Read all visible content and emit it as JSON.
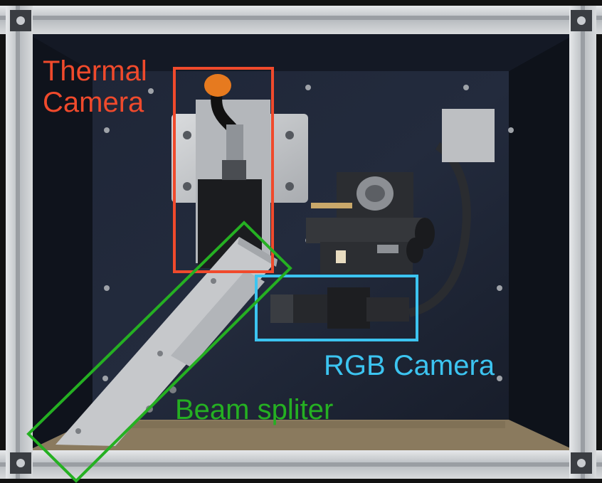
{
  "annotations": {
    "thermal": {
      "line1": "Thermal",
      "line2": "Camera",
      "color": "#f04a2c"
    },
    "rgb": {
      "text": "RGB Camera",
      "color": "#3cc4f0"
    },
    "beam": {
      "text": "Beam spliter",
      "color": "#25b022"
    }
  },
  "colors": {
    "frame": "#c9ccd0",
    "panel": "#1c2233",
    "floor": "#8a7a5e"
  }
}
